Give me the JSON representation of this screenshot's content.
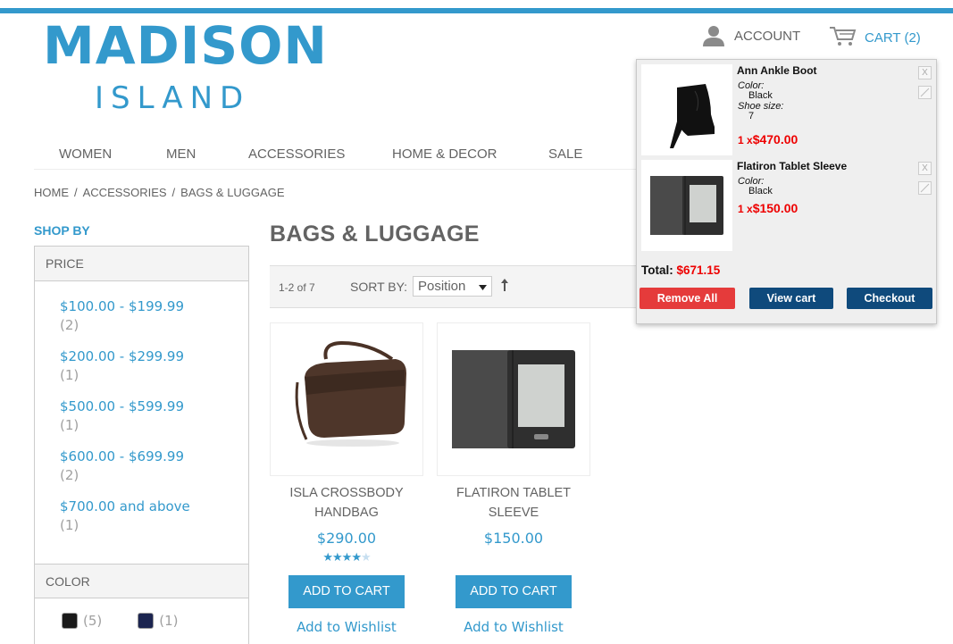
{
  "brand": {
    "line1": "MADISON",
    "line2": "ISLAND",
    "accent": "#3399cc"
  },
  "header": {
    "account_label": "ACCOUNT",
    "cart_label": "CART (2)"
  },
  "nav": [
    "WOMEN",
    "MEN",
    "ACCESSORIES",
    "HOME & DECOR",
    "SALE"
  ],
  "breadcrumb": [
    "HOME",
    "ACCESSORIES",
    "BAGS & LUGGAGE"
  ],
  "sidebar": {
    "title": "SHOP BY",
    "price_heading": "PRICE",
    "prices": [
      {
        "range": "$100.00 - $199.99",
        "count": "(2)"
      },
      {
        "range": "$200.00 - $299.99",
        "count": "(1)"
      },
      {
        "range": "$500.00 - $599.99",
        "count": "(1)"
      },
      {
        "range": "$600.00 - $699.99",
        "count": "(2)"
      },
      {
        "range": "$700.00 and above",
        "count": "(1)"
      }
    ],
    "color_heading": "COLOR",
    "colors": [
      {
        "count": "(5)",
        "color": "#1a1a1a"
      },
      {
        "count": "(1)",
        "color": "#1c2550"
      }
    ]
  },
  "category": {
    "title": "BAGS & LUGGAGE"
  },
  "toolbar": {
    "count": "1-2 of 7",
    "sort_label": "SORT BY:",
    "sort_value": "Position"
  },
  "products": [
    {
      "name_line1": "ISLA CROSSBODY",
      "name_line2": "HANDBAG",
      "price": "$290.00",
      "rating": 0.9,
      "add_label": "ADD TO CART",
      "wish_label": "Add to Wishlist"
    },
    {
      "name_line1": "FLATIRON TABLET",
      "name_line2": "SLEEVE",
      "price": "$150.00",
      "add_label": "ADD TO CART",
      "wish_label": "Add to Wishlist"
    }
  ],
  "minicart": {
    "items": [
      {
        "name": "Ann Ankle Boot",
        "options": [
          {
            "label": "Color:",
            "value": "Black"
          },
          {
            "label": "Shoe size:",
            "value": "7"
          }
        ],
        "qty": "1 x",
        "price": "$470.00"
      },
      {
        "name": "Flatiron Tablet Sleeve",
        "options": [
          {
            "label": "Color:",
            "value": "Black"
          }
        ],
        "qty": "1 x",
        "price": "$150.00"
      }
    ],
    "total_label": "Total:",
    "total_value": "$671.15",
    "remove_all": "Remove All",
    "view_cart": "View cart",
    "checkout": "Checkout",
    "remove_icon": "X"
  }
}
